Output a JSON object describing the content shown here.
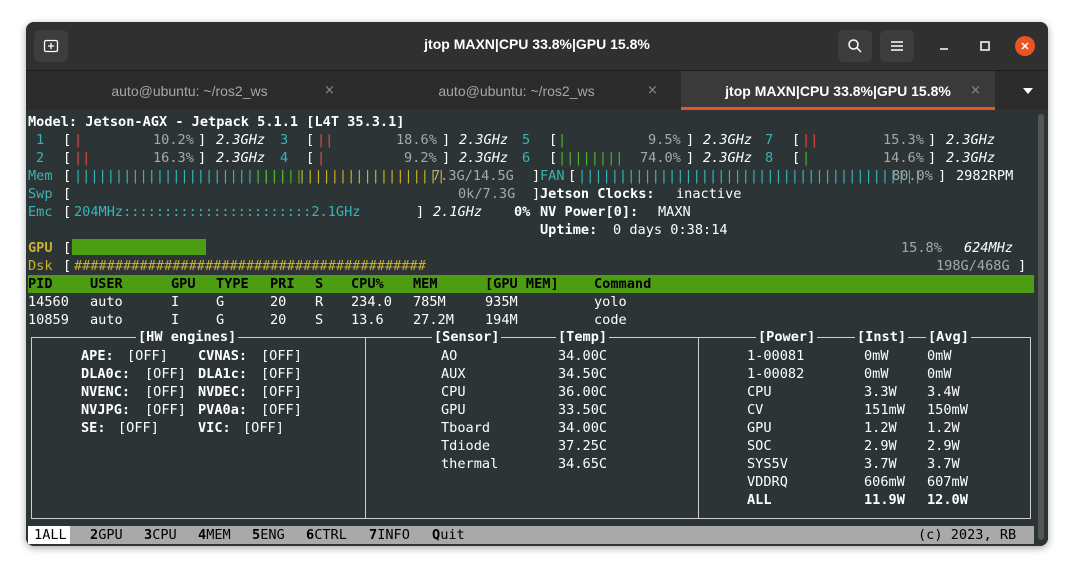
{
  "window": {
    "title": "jtop MAXN|CPU 33.8%|GPU 15.8%",
    "tabs": [
      {
        "label": "auto@ubuntu: ~/ros2_ws"
      },
      {
        "label": "auto@ubuntu: ~/ros2_ws"
      },
      {
        "label": "jtop MAXN|CPU 33.8%|GPU 15.8%"
      }
    ],
    "tab_close": "×",
    "icons": [
      "new-tab-icon",
      "search-icon",
      "menu-icon",
      "minimize-icon",
      "maximize-icon",
      "close-icon",
      "tabs-dropdown-icon"
    ]
  },
  "model_line": "Model: Jetson-AGX - Jetpack 5.1.1 [L4T 35.3.1]",
  "cpus": [
    {
      "id": "1",
      "bar": "|",
      "pct": "10.2%",
      "freq": "2.3GHz"
    },
    {
      "id": "3",
      "bar": "||",
      "pct": "18.6%",
      "freq": "2.3GHz"
    },
    {
      "id": "5",
      "bar": "|",
      "pct": "9.5%",
      "freq": "2.3GHz"
    },
    {
      "id": "7",
      "bar": "||",
      "pct": "15.3%",
      "freq": "2.3GHz"
    },
    {
      "id": "2",
      "bar": "||",
      "pct": "16.3%",
      "freq": "2.3GHz"
    },
    {
      "id": "4",
      "bar": "|",
      "pct": "9.2%",
      "freq": "2.3GHz"
    },
    {
      "id": "6",
      "bar": "||||||||",
      "pct": "74.0%",
      "freq": "2.3GHz"
    },
    {
      "id": "8",
      "bar": "|",
      "pct": "14.6%",
      "freq": "2.3GHz"
    }
  ],
  "mem": {
    "label": "Mem",
    "bar_a": "||||||||||||||||||||||||||",
    "bar_b": "||||||",
    "bar_c": "||||||||||||||||||",
    "value": "7.3G/14.5G"
  },
  "fan": {
    "label": "FAN",
    "bar": "||||||||||||||||||||||||||||||||||||||||||",
    "pct": "80.0%",
    "rpm": "2982RPM"
  },
  "swp": {
    "label": "Swp",
    "value": "0k/7.3G"
  },
  "jetson_clocks": {
    "label": "Jetson Clocks:",
    "value": "inactive"
  },
  "emc": {
    "label": "Emc",
    "bar": "204MHz:::::::::::::::::::::::2.1GHz",
    "freq": "2.1GHz",
    "pct": "0%"
  },
  "nv_power": {
    "label": "NV Power[0]:",
    "value": "MAXN"
  },
  "uptime": {
    "label": "Uptime:",
    "value": "0 days 0:38:14"
  },
  "gpu": {
    "label": "GPU",
    "pct": "15.8%",
    "freq": "624MHz",
    "level": 0.158
  },
  "dsk": {
    "label": "Dsk",
    "bar": "###########################################",
    "value": "198G/468G"
  },
  "process_headers": [
    "PID",
    "USER",
    "GPU",
    "TYPE",
    "PRI",
    "S",
    "CPU%",
    "MEM",
    "[GPU MEM]",
    "Command"
  ],
  "processes": [
    [
      "14560",
      "auto",
      "I",
      "G",
      "20",
      "R",
      "234.0",
      "785M",
      "935M",
      "yolo"
    ],
    [
      "10859",
      "auto",
      "I",
      "G",
      "20",
      "S",
      "13.6",
      "27.2M",
      "194M",
      "code"
    ]
  ],
  "hw_engines": {
    "title": "[HW engines]",
    "rows": [
      [
        {
          "k": "APE:",
          "v": "[OFF]"
        },
        {
          "k": "CVNAS:",
          "v": "[OFF]"
        }
      ],
      [
        {
          "k": "DLA0c:",
          "v": "[OFF]"
        },
        {
          "k": "DLA1c:",
          "v": "[OFF]"
        }
      ],
      [
        {
          "k": "NVENC:",
          "v": "[OFF]"
        },
        {
          "k": "NVDEC:",
          "v": "[OFF]"
        }
      ],
      [
        {
          "k": "NVJPG:",
          "v": "[OFF]"
        },
        {
          "k": "PVA0a:",
          "v": "[OFF]"
        }
      ],
      [
        {
          "k": "SE:",
          "v": "[OFF]"
        },
        {
          "k": "VIC:",
          "v": "[OFF]"
        }
      ]
    ]
  },
  "sensors": {
    "title_sensor": "[Sensor]",
    "title_temp": "[Temp]",
    "rows": [
      [
        "AO",
        "34.00C"
      ],
      [
        "AUX",
        "34.50C"
      ],
      [
        "CPU",
        "36.00C"
      ],
      [
        "GPU",
        "33.50C"
      ],
      [
        "Tboard",
        "34.00C"
      ],
      [
        "Tdiode",
        "37.25C"
      ],
      [
        "thermal",
        "34.65C"
      ]
    ]
  },
  "power": {
    "title_power": "[Power]",
    "title_inst": "[Inst]",
    "title_avg": "[Avg]",
    "rows": [
      [
        "1-00081",
        "0mW",
        "0mW"
      ],
      [
        "1-00082",
        "0mW",
        "0mW"
      ],
      [
        "CPU",
        "3.3W",
        "3.4W"
      ],
      [
        "CV",
        "151mW",
        "150mW"
      ],
      [
        "GPU",
        "1.2W",
        "1.2W"
      ],
      [
        "SOC",
        "2.9W",
        "2.9W"
      ],
      [
        "SYS5V",
        "3.7W",
        "3.7W"
      ],
      [
        "VDDRQ",
        "606mW",
        "607mW"
      ]
    ],
    "total": [
      "ALL",
      "11.9W",
      "12.0W"
    ]
  },
  "footer": {
    "tabs": [
      {
        "key": "1",
        "label": "ALL"
      },
      {
        "key": "2",
        "label": "GPU"
      },
      {
        "key": "3",
        "label": "CPU"
      },
      {
        "key": "4",
        "label": "MEM"
      },
      {
        "key": "5",
        "label": "ENG"
      },
      {
        "key": "6",
        "label": "CTRL"
      },
      {
        "key": "7",
        "label": "INFO"
      },
      {
        "key": "Q",
        "label": "uit"
      }
    ],
    "copyright": "(c) 2023, RB"
  },
  "colors": {
    "accent": "#e95420",
    "green": "#4d9d12",
    "terminal_bg": "#2d3436",
    "cyan": "#38b5b5"
  }
}
